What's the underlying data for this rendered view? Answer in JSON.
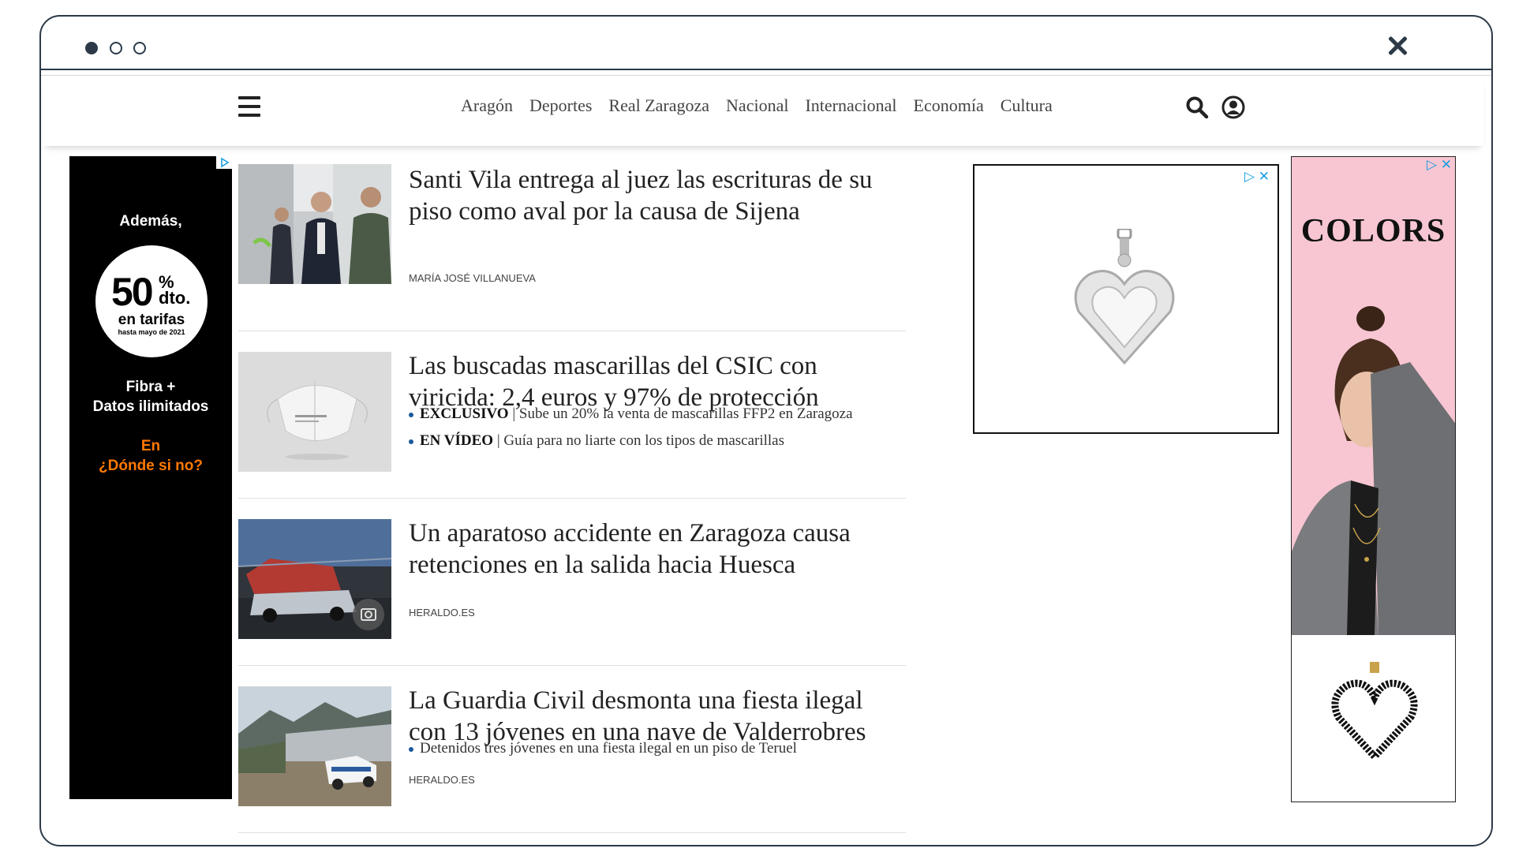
{
  "navbar": {
    "menu": [
      "Aragón",
      "Deportes",
      "Real Zaragoza",
      "Nacional",
      "Internacional",
      "Economía",
      "Cultura"
    ]
  },
  "ad_left": {
    "line1": "Además,",
    "big_number": "50",
    "percent": "%",
    "dto": "dto.",
    "tarifas": "en tarifas",
    "hasta": "hasta mayo de 2021",
    "fibra_line1": "Fibra +",
    "fibra_line2": "Datos ilimitados",
    "en_line1": "En",
    "en_line2": "¿Dónde si no?"
  },
  "articles": [
    {
      "headline": "Santi Vila entrega al juez las escrituras de su piso como aval por la causa de Sijena",
      "byline": "MARÍA JOSÉ VILLANUEVA"
    },
    {
      "headline": "Las buscadas mascarillas del CSIC con viricida: 2,4 euros y 97% de protección",
      "related": [
        {
          "tag": "EXCLUSIVO",
          "text": "| Sube un 20% la venta de mascarillas FFP2 en Zaragoza"
        },
        {
          "tag": "EN VÍDEO",
          "text": "| Guía para no liarte con los tipos de mascarillas"
        }
      ]
    },
    {
      "headline": "Un aparatoso accidente en Zaragoza causa retenciones en la salida hacia Huesca",
      "byline": "HERALDO.ES"
    },
    {
      "headline": "La Guardia Civil desmonta una fiesta ilegal con 13 jóvenes en una nave de Valderrobres",
      "related": [
        {
          "tag": "",
          "text": "Detenidos tres jóvenes en una fiesta ilegal en un piso de Teruel"
        }
      ],
      "byline": "HERALDO.ES"
    }
  ],
  "ad_mid": {
    "controls": "▷ ✕"
  },
  "ad_right": {
    "brand": "COLORS",
    "controls": "▷ ✕"
  },
  "colors": {
    "frame": "#2c3a47",
    "bullet": "#1a5a9c",
    "orange": "#ff7900",
    "pink": "#f7c6d2"
  }
}
